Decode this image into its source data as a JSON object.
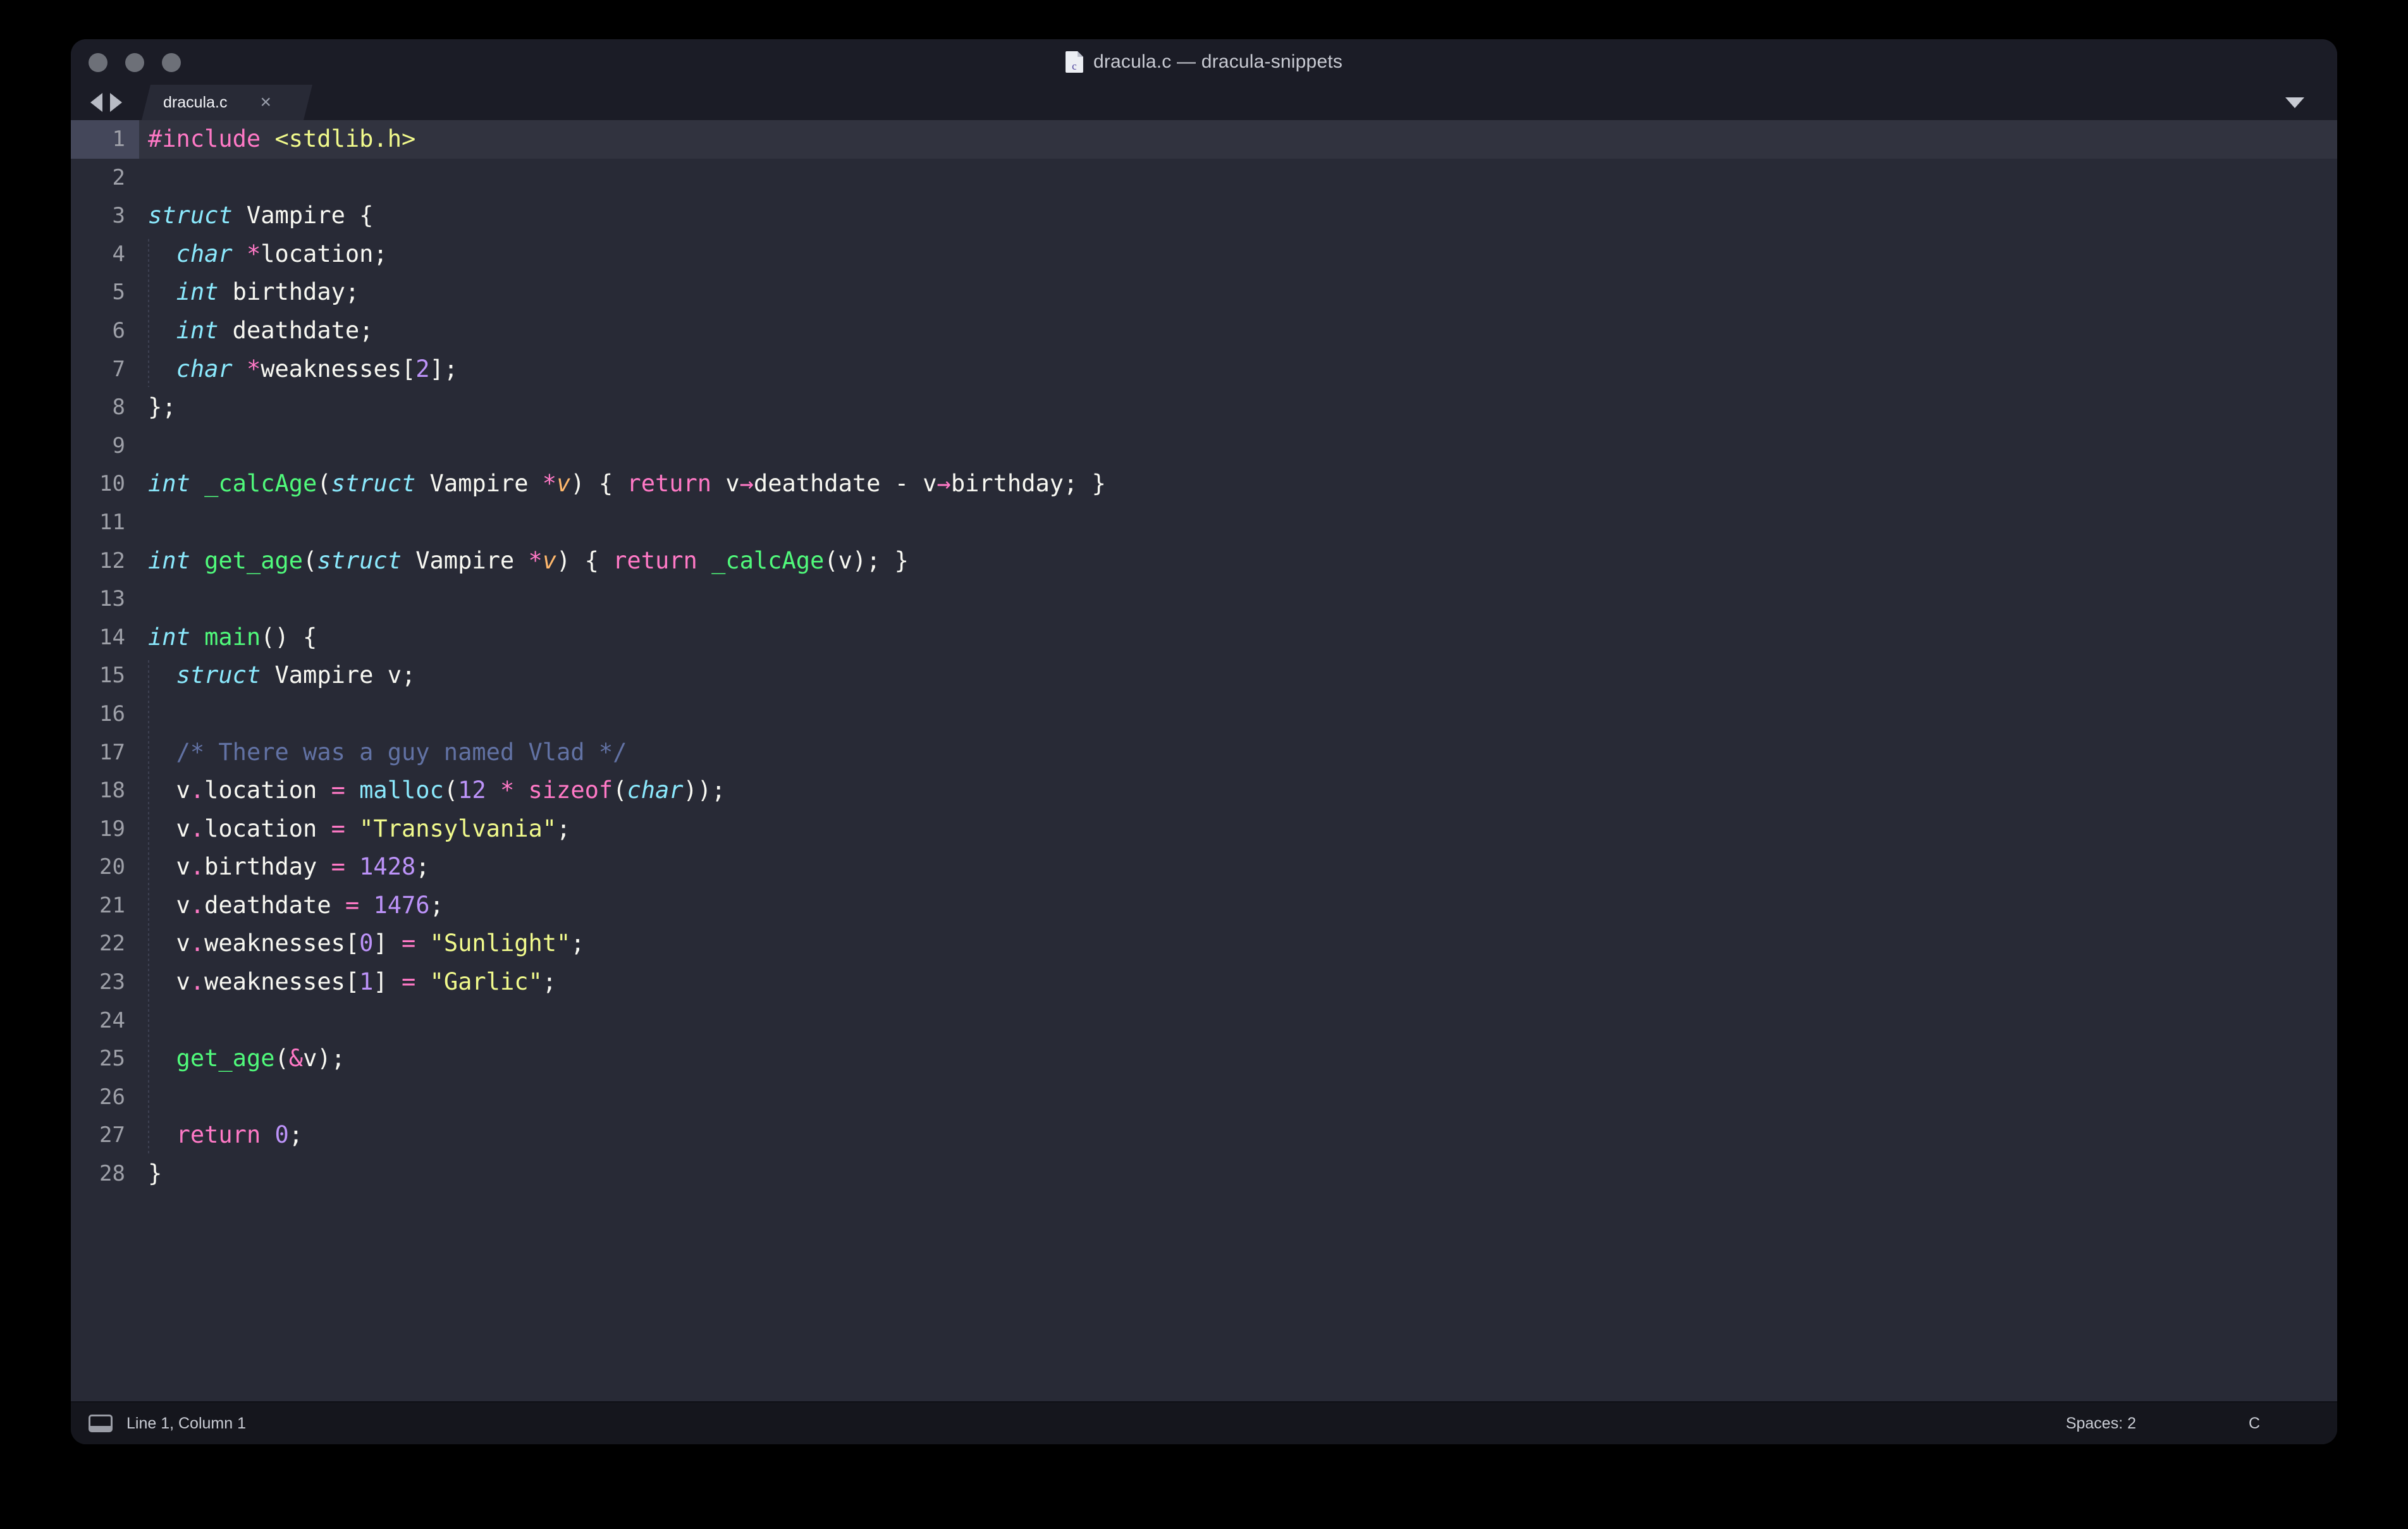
{
  "window": {
    "title": "dracula.c — dracula-snippets",
    "doc_icon_letter": "c",
    "traffic_lights": [
      "close",
      "minimize",
      "maximize"
    ]
  },
  "tabbar": {
    "nav_back_icon": "triangle-left-icon",
    "nav_forward_icon": "triangle-right-icon",
    "tabs": [
      {
        "label": "dracula.c",
        "close_label": "×",
        "active": true
      }
    ],
    "menu_icon": "triangle-down-icon"
  },
  "statusbar": {
    "console_icon": "console-panel-icon",
    "cursor_position": "Line 1, Column 1",
    "indentation": "Spaces: 2",
    "syntax": "C"
  },
  "theme": {
    "name": "Dracula",
    "background": "#282a36",
    "foreground": "#f8f8f2",
    "comment": "#6272a4",
    "cyan": "#8be9fd",
    "green": "#50fa7b",
    "orange": "#ffb86c",
    "pink": "#ff79c6",
    "purple": "#bd93f9",
    "yellow": "#f1fa8c",
    "selection": "#44475a",
    "chrome": "#1b1c26",
    "statusbar": "#15161d"
  },
  "editor": {
    "language": "C",
    "active_line": 1,
    "total_lines": 28,
    "lines": [
      {
        "n": 1,
        "active": true,
        "tokens": [
          {
            "t": "#include ",
            "c": "t-pink"
          },
          {
            "t": "<stdlib.h>",
            "c": "t-yellow"
          }
        ]
      },
      {
        "n": 2,
        "tokens": []
      },
      {
        "n": 3,
        "tokens": [
          {
            "t": "struct",
            "c": "t-cyan-i"
          },
          {
            "t": " Vampire {",
            "c": "t-fg"
          }
        ]
      },
      {
        "n": 4,
        "tokens": [
          {
            "t": "  ",
            "c": "t-fg"
          },
          {
            "t": "char",
            "c": "t-cyan-i"
          },
          {
            "t": " ",
            "c": "t-fg"
          },
          {
            "t": "*",
            "c": "t-pink"
          },
          {
            "t": "location;",
            "c": "t-fg"
          }
        ]
      },
      {
        "n": 5,
        "tokens": [
          {
            "t": "  ",
            "c": "t-fg"
          },
          {
            "t": "int",
            "c": "t-cyan-i"
          },
          {
            "t": " birthday;",
            "c": "t-fg"
          }
        ]
      },
      {
        "n": 6,
        "tokens": [
          {
            "t": "  ",
            "c": "t-fg"
          },
          {
            "t": "int",
            "c": "t-cyan-i"
          },
          {
            "t": " deathdate;",
            "c": "t-fg"
          }
        ]
      },
      {
        "n": 7,
        "tokens": [
          {
            "t": "  ",
            "c": "t-fg"
          },
          {
            "t": "char",
            "c": "t-cyan-i"
          },
          {
            "t": " ",
            "c": "t-fg"
          },
          {
            "t": "*",
            "c": "t-pink"
          },
          {
            "t": "weaknesses[",
            "c": "t-fg"
          },
          {
            "t": "2",
            "c": "t-purple"
          },
          {
            "t": "];",
            "c": "t-fg"
          }
        ]
      },
      {
        "n": 8,
        "tokens": [
          {
            "t": "};",
            "c": "t-fg"
          }
        ]
      },
      {
        "n": 9,
        "tokens": []
      },
      {
        "n": 10,
        "tokens": [
          {
            "t": "int",
            "c": "t-cyan-i"
          },
          {
            "t": " ",
            "c": "t-fg"
          },
          {
            "t": "_calcAge",
            "c": "t-green"
          },
          {
            "t": "(",
            "c": "t-fg"
          },
          {
            "t": "struct",
            "c": "t-cyan-i"
          },
          {
            "t": " Vampire ",
            "c": "t-fg"
          },
          {
            "t": "*",
            "c": "t-pink"
          },
          {
            "t": "v",
            "c": "t-orange-i"
          },
          {
            "t": ") { ",
            "c": "t-fg"
          },
          {
            "t": "return",
            "c": "t-pink"
          },
          {
            "t": " v",
            "c": "t-fg"
          },
          {
            "t": "→",
            "c": "t-pink"
          },
          {
            "t": "deathdate ",
            "c": "t-fg"
          },
          {
            "t": "-",
            "c": "t-fg"
          },
          {
            "t": " v",
            "c": "t-fg"
          },
          {
            "t": "→",
            "c": "t-pink"
          },
          {
            "t": "birthday; }",
            "c": "t-fg"
          }
        ]
      },
      {
        "n": 11,
        "tokens": []
      },
      {
        "n": 12,
        "tokens": [
          {
            "t": "int",
            "c": "t-cyan-i"
          },
          {
            "t": " ",
            "c": "t-fg"
          },
          {
            "t": "get_age",
            "c": "t-green"
          },
          {
            "t": "(",
            "c": "t-fg"
          },
          {
            "t": "struct",
            "c": "t-cyan-i"
          },
          {
            "t": " Vampire ",
            "c": "t-fg"
          },
          {
            "t": "*",
            "c": "t-pink"
          },
          {
            "t": "v",
            "c": "t-orange-i"
          },
          {
            "t": ") { ",
            "c": "t-fg"
          },
          {
            "t": "return",
            "c": "t-pink"
          },
          {
            "t": " ",
            "c": "t-fg"
          },
          {
            "t": "_calcAge",
            "c": "t-green"
          },
          {
            "t": "(v); }",
            "c": "t-fg"
          }
        ]
      },
      {
        "n": 13,
        "tokens": []
      },
      {
        "n": 14,
        "tokens": [
          {
            "t": "int",
            "c": "t-cyan-i"
          },
          {
            "t": " ",
            "c": "t-fg"
          },
          {
            "t": "main",
            "c": "t-green"
          },
          {
            "t": "() {",
            "c": "t-fg"
          }
        ]
      },
      {
        "n": 15,
        "tokens": [
          {
            "t": "  ",
            "c": "t-fg"
          },
          {
            "t": "struct",
            "c": "t-cyan-i"
          },
          {
            "t": " Vampire v;",
            "c": "t-fg"
          }
        ]
      },
      {
        "n": 16,
        "tokens": []
      },
      {
        "n": 17,
        "tokens": [
          {
            "t": "  ",
            "c": "t-fg"
          },
          {
            "t": "/* There was a guy named Vlad */",
            "c": "t-comment"
          }
        ]
      },
      {
        "n": 18,
        "tokens": [
          {
            "t": "  v",
            "c": "t-fg"
          },
          {
            "t": ".",
            "c": "t-pink"
          },
          {
            "t": "location ",
            "c": "t-fg"
          },
          {
            "t": "=",
            "c": "t-pink"
          },
          {
            "t": " ",
            "c": "t-fg"
          },
          {
            "t": "malloc",
            "c": "t-cyan"
          },
          {
            "t": "(",
            "c": "t-fg"
          },
          {
            "t": "12",
            "c": "t-purple"
          },
          {
            "t": " ",
            "c": "t-fg"
          },
          {
            "t": "*",
            "c": "t-pink"
          },
          {
            "t": " ",
            "c": "t-fg"
          },
          {
            "t": "sizeof",
            "c": "t-pink"
          },
          {
            "t": "(",
            "c": "t-fg"
          },
          {
            "t": "char",
            "c": "t-cyan-i"
          },
          {
            "t": "));",
            "c": "t-fg"
          }
        ]
      },
      {
        "n": 19,
        "tokens": [
          {
            "t": "  v",
            "c": "t-fg"
          },
          {
            "t": ".",
            "c": "t-pink"
          },
          {
            "t": "location ",
            "c": "t-fg"
          },
          {
            "t": "=",
            "c": "t-pink"
          },
          {
            "t": " ",
            "c": "t-fg"
          },
          {
            "t": "\"Transylvania\"",
            "c": "t-yellow"
          },
          {
            "t": ";",
            "c": "t-fg"
          }
        ]
      },
      {
        "n": 20,
        "tokens": [
          {
            "t": "  v",
            "c": "t-fg"
          },
          {
            "t": ".",
            "c": "t-pink"
          },
          {
            "t": "birthday ",
            "c": "t-fg"
          },
          {
            "t": "=",
            "c": "t-pink"
          },
          {
            "t": " ",
            "c": "t-fg"
          },
          {
            "t": "1428",
            "c": "t-purple"
          },
          {
            "t": ";",
            "c": "t-fg"
          }
        ]
      },
      {
        "n": 21,
        "tokens": [
          {
            "t": "  v",
            "c": "t-fg"
          },
          {
            "t": ".",
            "c": "t-pink"
          },
          {
            "t": "deathdate ",
            "c": "t-fg"
          },
          {
            "t": "=",
            "c": "t-pink"
          },
          {
            "t": " ",
            "c": "t-fg"
          },
          {
            "t": "1476",
            "c": "t-purple"
          },
          {
            "t": ";",
            "c": "t-fg"
          }
        ]
      },
      {
        "n": 22,
        "tokens": [
          {
            "t": "  v",
            "c": "t-fg"
          },
          {
            "t": ".",
            "c": "t-pink"
          },
          {
            "t": "weaknesses[",
            "c": "t-fg"
          },
          {
            "t": "0",
            "c": "t-purple"
          },
          {
            "t": "] ",
            "c": "t-fg"
          },
          {
            "t": "=",
            "c": "t-pink"
          },
          {
            "t": " ",
            "c": "t-fg"
          },
          {
            "t": "\"Sunlight\"",
            "c": "t-yellow"
          },
          {
            "t": ";",
            "c": "t-fg"
          }
        ]
      },
      {
        "n": 23,
        "tokens": [
          {
            "t": "  v",
            "c": "t-fg"
          },
          {
            "t": ".",
            "c": "t-pink"
          },
          {
            "t": "weaknesses[",
            "c": "t-fg"
          },
          {
            "t": "1",
            "c": "t-purple"
          },
          {
            "t": "] ",
            "c": "t-fg"
          },
          {
            "t": "=",
            "c": "t-pink"
          },
          {
            "t": " ",
            "c": "t-fg"
          },
          {
            "t": "\"Garlic\"",
            "c": "t-yellow"
          },
          {
            "t": ";",
            "c": "t-fg"
          }
        ]
      },
      {
        "n": 24,
        "tokens": []
      },
      {
        "n": 25,
        "tokens": [
          {
            "t": "  ",
            "c": "t-fg"
          },
          {
            "t": "get_age",
            "c": "t-green"
          },
          {
            "t": "(",
            "c": "t-fg"
          },
          {
            "t": "&",
            "c": "t-pink"
          },
          {
            "t": "v);",
            "c": "t-fg"
          }
        ]
      },
      {
        "n": 26,
        "tokens": []
      },
      {
        "n": 27,
        "tokens": [
          {
            "t": "  ",
            "c": "t-fg"
          },
          {
            "t": "return",
            "c": "t-pink"
          },
          {
            "t": " ",
            "c": "t-fg"
          },
          {
            "t": "0",
            "c": "t-purple"
          },
          {
            "t": ";",
            "c": "t-fg"
          }
        ]
      },
      {
        "n": 28,
        "tokens": [
          {
            "t": "}",
            "c": "t-fg"
          }
        ]
      }
    ],
    "indent_guides": [
      {
        "from_line": 4,
        "to_line": 7
      },
      {
        "from_line": 15,
        "to_line": 27
      }
    ]
  }
}
